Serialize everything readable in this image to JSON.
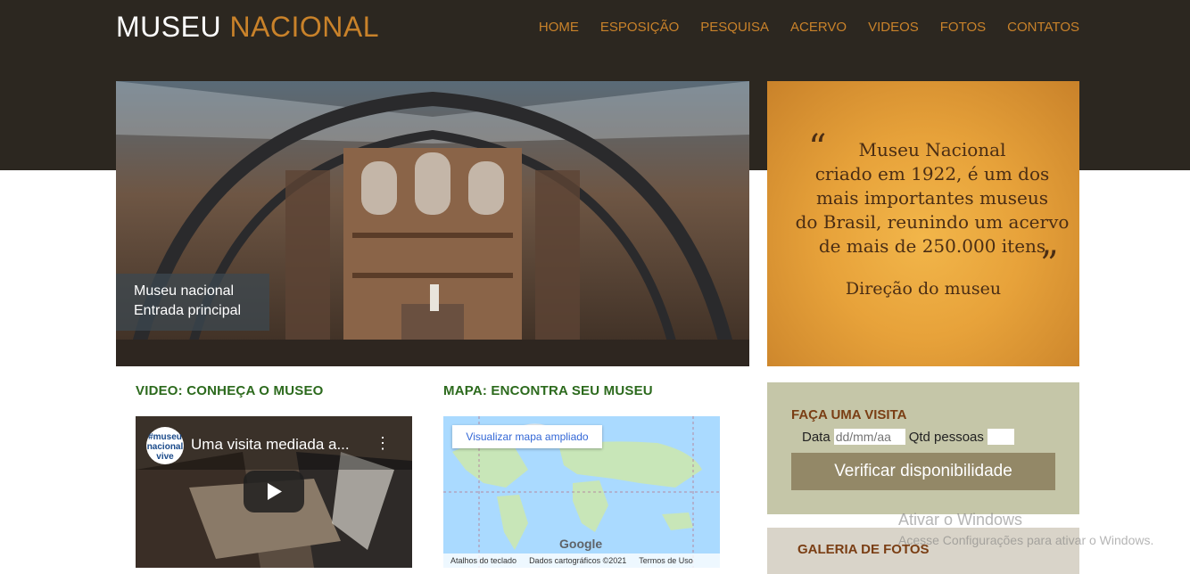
{
  "header": {
    "logo_part1": "MUSEU",
    "logo_part2": "NACIONAL",
    "nav": [
      "HOME",
      "ESPOSIÇÃO",
      "PESQUISA",
      "ACERVO",
      "VIDEOS",
      "FOTOS",
      "CONTATOS"
    ]
  },
  "hero": {
    "caption_line1": "Museu nacional",
    "caption_line2": "Entrada principal"
  },
  "quote": {
    "open_mark": "“",
    "close_mark": "”",
    "lines": [
      "Museu Nacional",
      "criado em 1922, é um dos",
      "mais importantes museus",
      "do Brasil, reunindo um acervo",
      "de mais de 250.000 itens"
    ],
    "author": "Direção do museu"
  },
  "video_section": {
    "heading": "VIDEO: CONHEÇA O MUSEO",
    "video_title": "Uma visita mediada a...",
    "channel_logo": [
      "#museu",
      "nacional",
      "vive"
    ],
    "menu_glyph": "⋮"
  },
  "map_section": {
    "heading": "MAPA: ENCONTRA SEU MUSEU",
    "open_map_label": "Visualizar mapa ampliado",
    "brand": "Google",
    "footer": [
      "Atalhos do teclado",
      "Dados cartográficos ©2021",
      "Termos de Uso"
    ]
  },
  "visit": {
    "heading": "FAÇA UMA VISITA",
    "date_label": "Data",
    "date_placeholder": "dd/mm/aa",
    "people_label": "Qtd pessoas",
    "button_label": "Verificar disponibilidade"
  },
  "gallery": {
    "heading": "GALERIA DE FOTOS"
  },
  "os_watermark": {
    "line1": "Ativar o Windows",
    "line2": "Acesse Configurações para ativar o Windows."
  },
  "colors": {
    "header_bg": "#2c2720",
    "accent_orange": "#c9822a",
    "section_green": "#2c6a1d",
    "visit_bg": "#c5c6a8",
    "button_bg": "#938867"
  }
}
